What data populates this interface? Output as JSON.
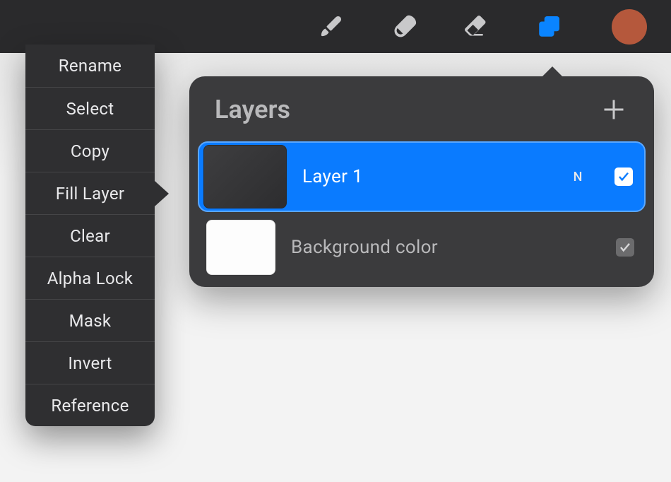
{
  "toolbar": {
    "tools": [
      {
        "name": "brush-icon",
        "active": false
      },
      {
        "name": "smudge-icon",
        "active": false
      },
      {
        "name": "eraser-icon",
        "active": false
      },
      {
        "name": "layers-icon",
        "active": true
      }
    ],
    "swatch_color": "#b5583c"
  },
  "layers_panel": {
    "title": "Layers",
    "layers": [
      {
        "name": "Layer 1",
        "blend_letter": "N",
        "visible": true,
        "selected": true,
        "thumb": "dark"
      },
      {
        "name": "Background color",
        "blend_letter": "",
        "visible": true,
        "selected": false,
        "thumb": "white"
      }
    ]
  },
  "context_menu": {
    "items": [
      {
        "label": "Rename",
        "active": false
      },
      {
        "label": "Select",
        "active": false
      },
      {
        "label": "Copy",
        "active": false
      },
      {
        "label": "Fill Layer",
        "active": true
      },
      {
        "label": "Clear",
        "active": false
      },
      {
        "label": "Alpha Lock",
        "active": false
      },
      {
        "label": "Mask",
        "active": false
      },
      {
        "label": "Invert",
        "active": false
      },
      {
        "label": "Reference",
        "active": false
      }
    ]
  }
}
